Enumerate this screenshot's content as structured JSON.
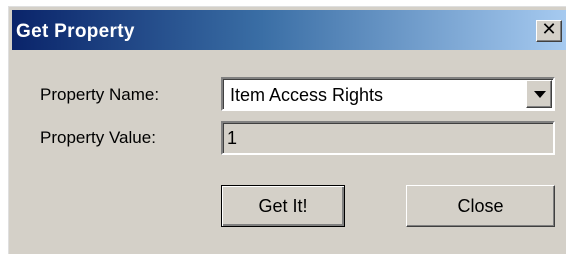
{
  "window": {
    "title": "Get Property"
  },
  "titlebar": {
    "close_glyph": "✕",
    "close_icon": "close-icon"
  },
  "form": {
    "property_name_label": "Property Name:",
    "property_name_value": "Item Access Rights",
    "property_value_label": "Property Value:",
    "property_value_value": "1"
  },
  "buttons": {
    "get_it_label": "Get It!",
    "close_label": "Close"
  },
  "colors": {
    "title_gradient_start": "#0a246a",
    "title_gradient_end": "#a6caf0",
    "dialog_face": "#d4d0c8"
  }
}
